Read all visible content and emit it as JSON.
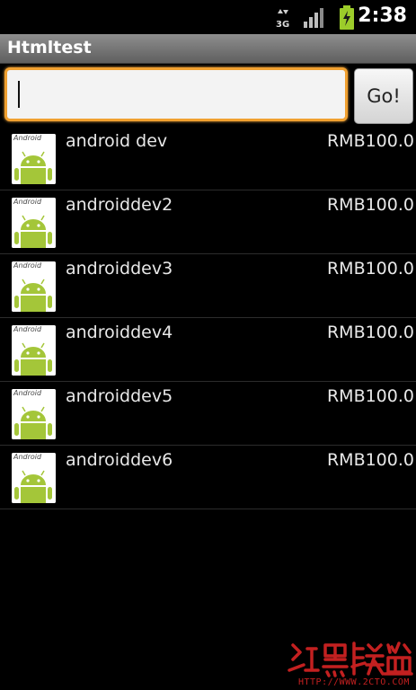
{
  "status_bar": {
    "network": "3G",
    "time": "2:38"
  },
  "app": {
    "title": "Htmltest"
  },
  "search": {
    "value": "",
    "button_label": "Go!"
  },
  "items": [
    {
      "name": "android dev",
      "price": "RMB100.0",
      "icon_text": "Android"
    },
    {
      "name": "androiddev2",
      "price": "RMB100.0",
      "icon_text": "Android"
    },
    {
      "name": "androiddev3",
      "price": "RMB100.0",
      "icon_text": "Android"
    },
    {
      "name": "androiddev4",
      "price": "RMB100.0",
      "icon_text": "Android"
    },
    {
      "name": "androiddev5",
      "price": "RMB100.0",
      "icon_text": "Android"
    },
    {
      "name": "androiddev6",
      "price": "RMB100.0",
      "icon_text": "Android"
    }
  ],
  "watermark": {
    "url": "HTTP://WWW.2CTO.COM",
    "logo_text": "红黑联盟"
  },
  "colors": {
    "focus_border": "#f0a030",
    "android_green": "#a4c639",
    "watermark_red": "#c32020"
  },
  "icons": [
    "3g-data-icon",
    "signal-icon",
    "battery-charging-icon",
    "android-robot-icon"
  ]
}
